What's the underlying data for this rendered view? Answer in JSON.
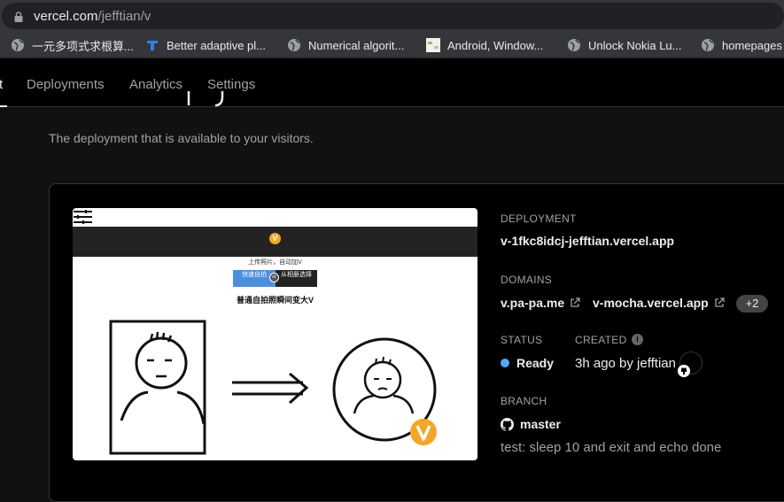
{
  "browser": {
    "url_host": "vercel.com",
    "url_path": "/jefftian/v",
    "bookmarks": [
      {
        "label": "一元多项式求根算...",
        "icon": "globe-icon"
      },
      {
        "label": "Better adaptive pl...",
        "icon": "bookmark-t-icon"
      },
      {
        "label": "Numerical algorit...",
        "icon": "globe-icon"
      },
      {
        "label": "Android, Window...",
        "icon": "image-placeholder-icon"
      },
      {
        "label": "Unlock Nokia Lu...",
        "icon": "globe-icon"
      },
      {
        "label": "homepages",
        "icon": "globe-icon"
      }
    ]
  },
  "nav": {
    "tabs": [
      "t",
      "Deployments",
      "Analytics",
      "Settings"
    ]
  },
  "page": {
    "subtitle": "The deployment that is available to your visitors."
  },
  "preview": {
    "logo_letter": "V",
    "upload_hint": "上传照片，自动加V",
    "btn_camera": "快速自拍",
    "btn_album": "从相册选择",
    "separator": "or",
    "caption": "普通自拍照瞬间变大V"
  },
  "deployment": {
    "deployment_label": "DEPLOYMENT",
    "deployment_url": "v-1fkc8idcj-jefftian.vercel.app",
    "domains_label": "DOMAINS",
    "domains": [
      "v.pa-pa.me",
      "v-mocha.vercel.app"
    ],
    "more_domains": "+2",
    "status_label": "STATUS",
    "status_value": "Ready",
    "status_color": "#52a8ff",
    "created_label": "CREATED",
    "created_value": "3h ago by jefftian",
    "branch_label": "BRANCH",
    "branch_value": "master",
    "commit_message": "test: sleep 10 and exit and echo done"
  },
  "colors": {
    "background": "#111111",
    "card": "#000000",
    "accent_v": "#f5a623"
  }
}
